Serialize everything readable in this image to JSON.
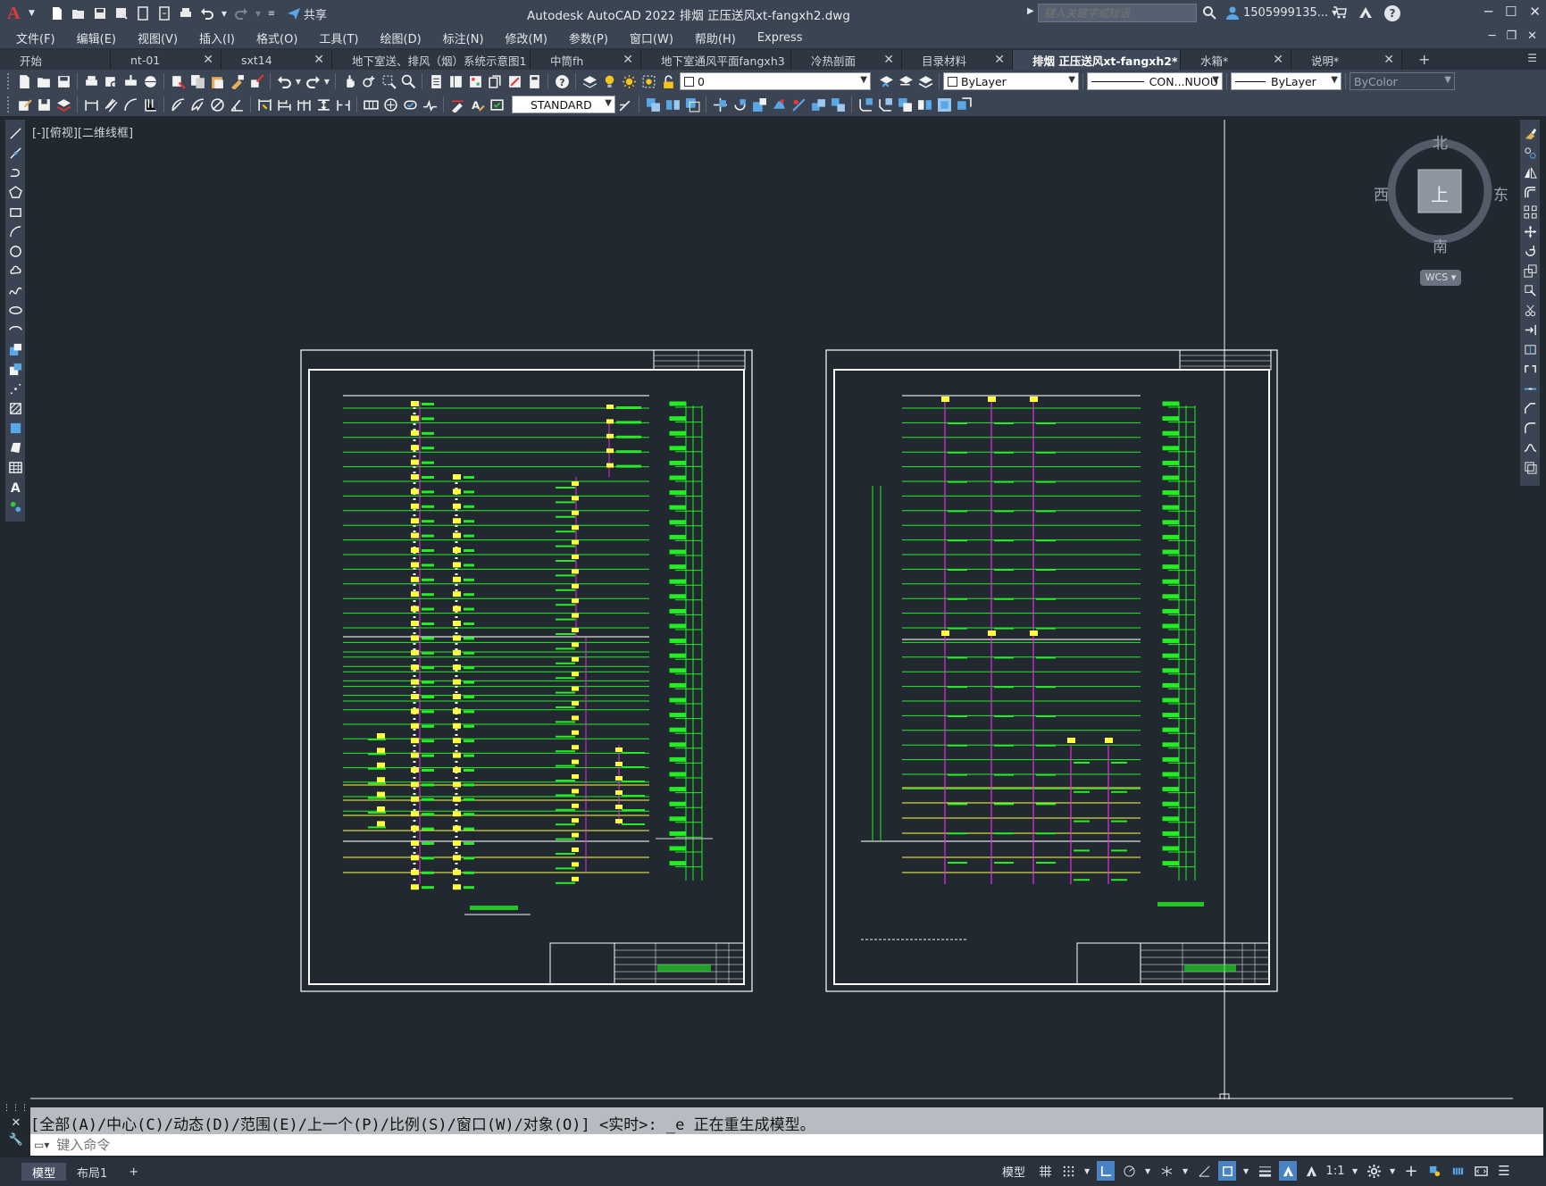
{
  "window": {
    "app_logo": "A",
    "title": "Autodesk AutoCAD 2022    排烟 正压送风xt-fangxh2.dwg",
    "share_label": "共享",
    "search_placeholder": "键入关键字或短语",
    "user": "1505999135...",
    "help": "?"
  },
  "menu": {
    "items": [
      "文件(F)",
      "编辑(E)",
      "视图(V)",
      "插入(I)",
      "格式(O)",
      "工具(T)",
      "绘图(D)",
      "标注(N)",
      "修改(M)",
      "参数(P)",
      "窗口(W)",
      "帮助(H)",
      "Express"
    ]
  },
  "tabs": [
    {
      "label": "开始",
      "active": false
    },
    {
      "label": "nt-01",
      "active": false
    },
    {
      "label": "sxt14",
      "active": false
    },
    {
      "label": "地下室送、排风（烟）系统示意图1",
      "active": false
    },
    {
      "label": "中筒fh",
      "active": false
    },
    {
      "label": "地下室通风平面fangxh3",
      "active": false
    },
    {
      "label": "冷热剖面",
      "active": false
    },
    {
      "label": "目录材料",
      "active": false
    },
    {
      "label": "排烟 正压送风xt-fangxh2*",
      "active": true
    },
    {
      "label": "水箱*",
      "active": false
    },
    {
      "label": "说明*",
      "active": false
    }
  ],
  "toolbar1": {
    "layer_value": "0",
    "color_value": "ByLayer",
    "linetype_value": "CON...NUOU",
    "lineweight_value": "ByLayer",
    "plotstyle_value": "ByColor"
  },
  "toolbar2": {
    "textstyle_value": "STANDARD"
  },
  "viewport": {
    "label": "[-][俯视][二维线框]"
  },
  "viewcube": {
    "north": "北",
    "south": "南",
    "east": "东",
    "west": "西",
    "face": "上",
    "wcs": "WCS"
  },
  "command": {
    "history": "[全部(A)/中心(C)/动态(D)/范围(E)/上一个(P)/比例(S)/窗口(W)/对象(O)] <实时>: _e 正在重生成模型。",
    "placeholder": "键入命令"
  },
  "status": {
    "layout_tabs": [
      "模型",
      "布局1"
    ],
    "add_tab": "+",
    "model_label": "模型",
    "scale": "1:1"
  },
  "colors": {
    "background": "#212830",
    "chrome": "#3b4453",
    "line_green": "#22ee22",
    "line_magenta": "#e030e0",
    "line_yellow": "#ffff40",
    "frame_white": "#ffffff"
  }
}
